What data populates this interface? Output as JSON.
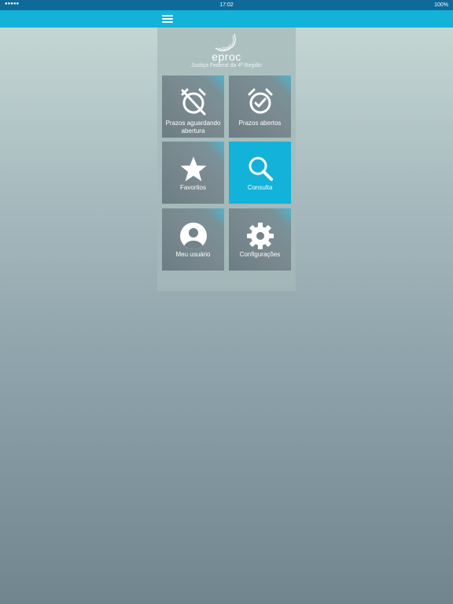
{
  "status_bar": {
    "signal": "●●●●●",
    "time": "17:02",
    "battery": "100%"
  },
  "logo": {
    "name": "eproc",
    "subtitle": "Justiça Federal da 4ª Região"
  },
  "tiles": [
    {
      "label": "Prazos aguardando abertura",
      "icon": "alarm-off-icon"
    },
    {
      "label": "Prazos abertos",
      "icon": "alarm-check-icon"
    },
    {
      "label": "Favoritos",
      "icon": "star-icon"
    },
    {
      "label": "Consulta",
      "icon": "search-icon"
    },
    {
      "label": "Meu usuário",
      "icon": "user-icon"
    },
    {
      "label": "Configurações",
      "icon": "gear-icon"
    }
  ],
  "colors": {
    "status_bar": "#0f6a99",
    "nav_bar": "#12b2d9",
    "active_tile": "#12b2d9",
    "tile": "#7a8a90"
  }
}
